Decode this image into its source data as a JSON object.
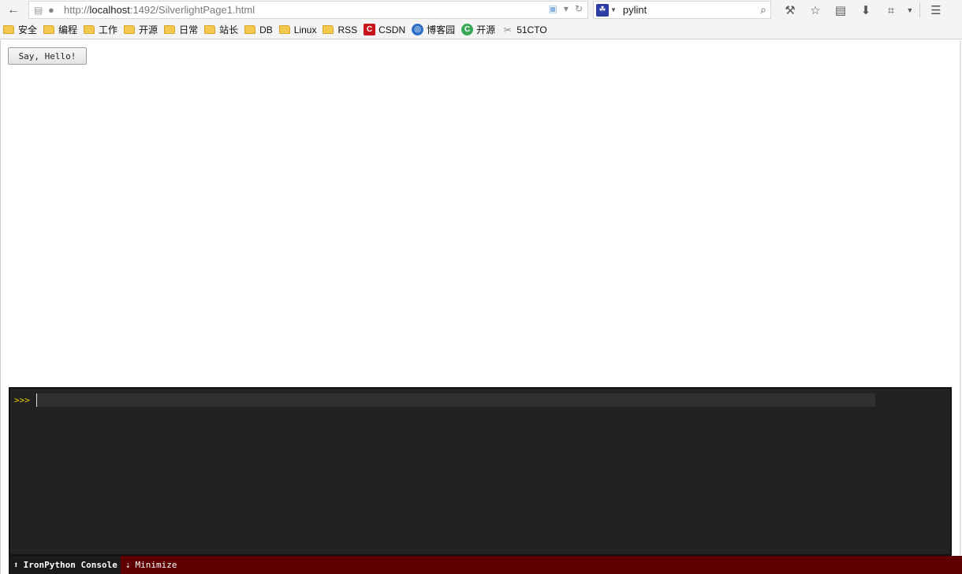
{
  "navbar": {
    "url_prefix": "http://",
    "url_host": "localhost",
    "url_rest": ":1492/SilverlightPage1.html",
    "search_text": "pylint"
  },
  "bookmarks": [
    {
      "label": "安全",
      "type": "folder"
    },
    {
      "label": "编程",
      "type": "folder"
    },
    {
      "label": "工作",
      "type": "folder"
    },
    {
      "label": "开源",
      "type": "folder"
    },
    {
      "label": "日常",
      "type": "folder"
    },
    {
      "label": "站长",
      "type": "folder"
    },
    {
      "label": "DB",
      "type": "folder"
    },
    {
      "label": "Linux",
      "type": "folder"
    },
    {
      "label": "RSS",
      "type": "folder"
    },
    {
      "label": "CSDN",
      "type": "site"
    },
    {
      "label": "博客园",
      "type": "site"
    },
    {
      "label": "开源",
      "type": "site"
    },
    {
      "label": "51CTO",
      "type": "site"
    }
  ],
  "page": {
    "button_label": "Say, Hello!"
  },
  "console": {
    "prompt": ">>>",
    "tabs": {
      "console_label": "IronPython Console",
      "minimize_label": "Minimize"
    }
  },
  "colors": {
    "console_bg": "#222222",
    "prompt": "#e6d200",
    "footer_bg": "#5e0000"
  }
}
